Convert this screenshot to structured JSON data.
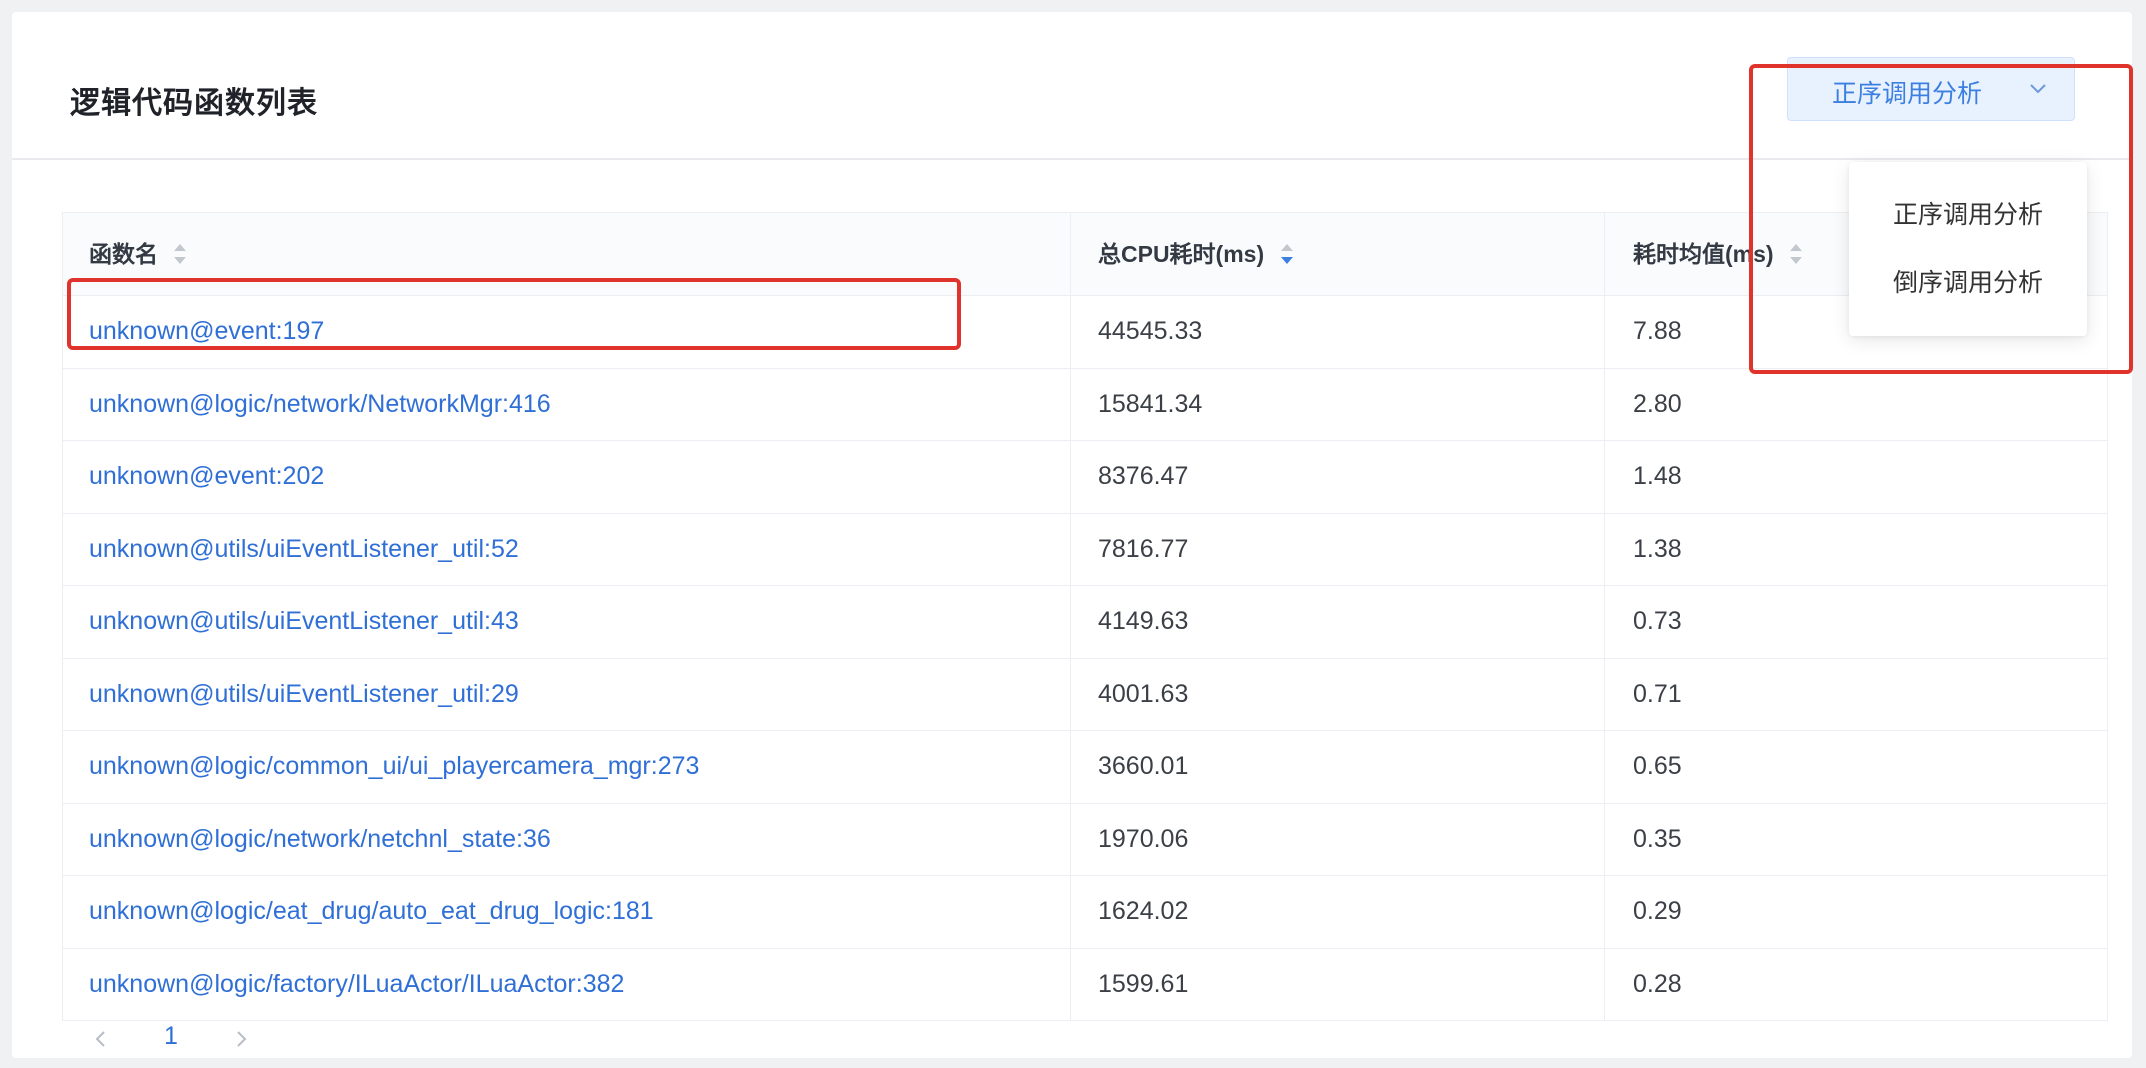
{
  "header": {
    "title": "逻辑代码函数列表"
  },
  "dropdown": {
    "selected": "正序调用分析",
    "options": [
      "正序调用分析",
      "倒序调用分析"
    ]
  },
  "table": {
    "columns": [
      {
        "label": "函数名",
        "sort": "none"
      },
      {
        "label": "总CPU耗时(ms)",
        "sort": "descending"
      },
      {
        "label": "耗时均值(ms)",
        "sort": "none"
      }
    ],
    "rows": [
      {
        "name": "unknown@event:197",
        "total": "44545.33",
        "avg": "7.88"
      },
      {
        "name": "unknown@logic/network/NetworkMgr:416",
        "total": "15841.34",
        "avg": "2.80"
      },
      {
        "name": "unknown@event:202",
        "total": "8376.47",
        "avg": "1.48"
      },
      {
        "name": "unknown@utils/uiEventListener_util:52",
        "total": "7816.77",
        "avg": "1.38"
      },
      {
        "name": "unknown@utils/uiEventListener_util:43",
        "total": "4149.63",
        "avg": "0.73"
      },
      {
        "name": "unknown@utils/uiEventListener_util:29",
        "total": "4001.63",
        "avg": "0.71"
      },
      {
        "name": "unknown@logic/common_ui/ui_playercamera_mgr:273",
        "total": "3660.01",
        "avg": "0.65"
      },
      {
        "name": "unknown@logic/network/netchnl_state:36",
        "total": "1970.06",
        "avg": "0.35"
      },
      {
        "name": "unknown@logic/eat_drug/auto_eat_drug_logic:181",
        "total": "1624.02",
        "avg": "0.29"
      },
      {
        "name": "unknown@logic/factory/ILuaActor/ILuaActor:382",
        "total": "1599.61",
        "avg": "0.28"
      }
    ]
  },
  "pagination": {
    "current": "1"
  },
  "colors": {
    "accent": "#2f6fd6",
    "highlight": "#e0332c",
    "dropdown_bg": "#e8f2ff"
  },
  "icons": {
    "dropdown": "chevron-down-icon",
    "sort": "sort-caret-icon",
    "prev": "chevron-left-icon",
    "next": "chevron-right-icon"
  }
}
